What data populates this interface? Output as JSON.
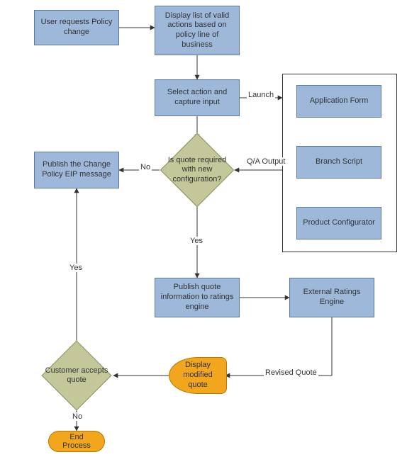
{
  "diagram": {
    "type": "flowchart",
    "nodes": {
      "user_requests": "User requests Policy change",
      "display_list": "Display list of valid actions based on policy line of business",
      "select_action": "Select action and capture input",
      "application_form": "Application Form",
      "branch_script": "Branch Script",
      "product_configurator": "Product Configurator",
      "quote_required": "Is quote required with new configuration?",
      "publish_eip": "Publish the Change Policy EIP message",
      "publish_quote": "Publish quote information to ratings engine",
      "external_engine": "External Ratings Engine",
      "display_quote": "Display modified quote",
      "customer_accepts": "Customer accepts quote",
      "end_process": "End Process"
    },
    "edges": {
      "launch": "Launch",
      "qa_output": "Q/A Output",
      "no": "No",
      "yes": "Yes",
      "revised_quote": "Revised Quote"
    },
    "palette": {
      "process_fill": "#9db8d9",
      "process_stroke": "#5b7ba5",
      "decision_fill": "#c4c79a",
      "decision_stroke": "#8d8f5e",
      "terminator_fill": "#f2a61e",
      "terminator_stroke": "#b77800"
    }
  }
}
